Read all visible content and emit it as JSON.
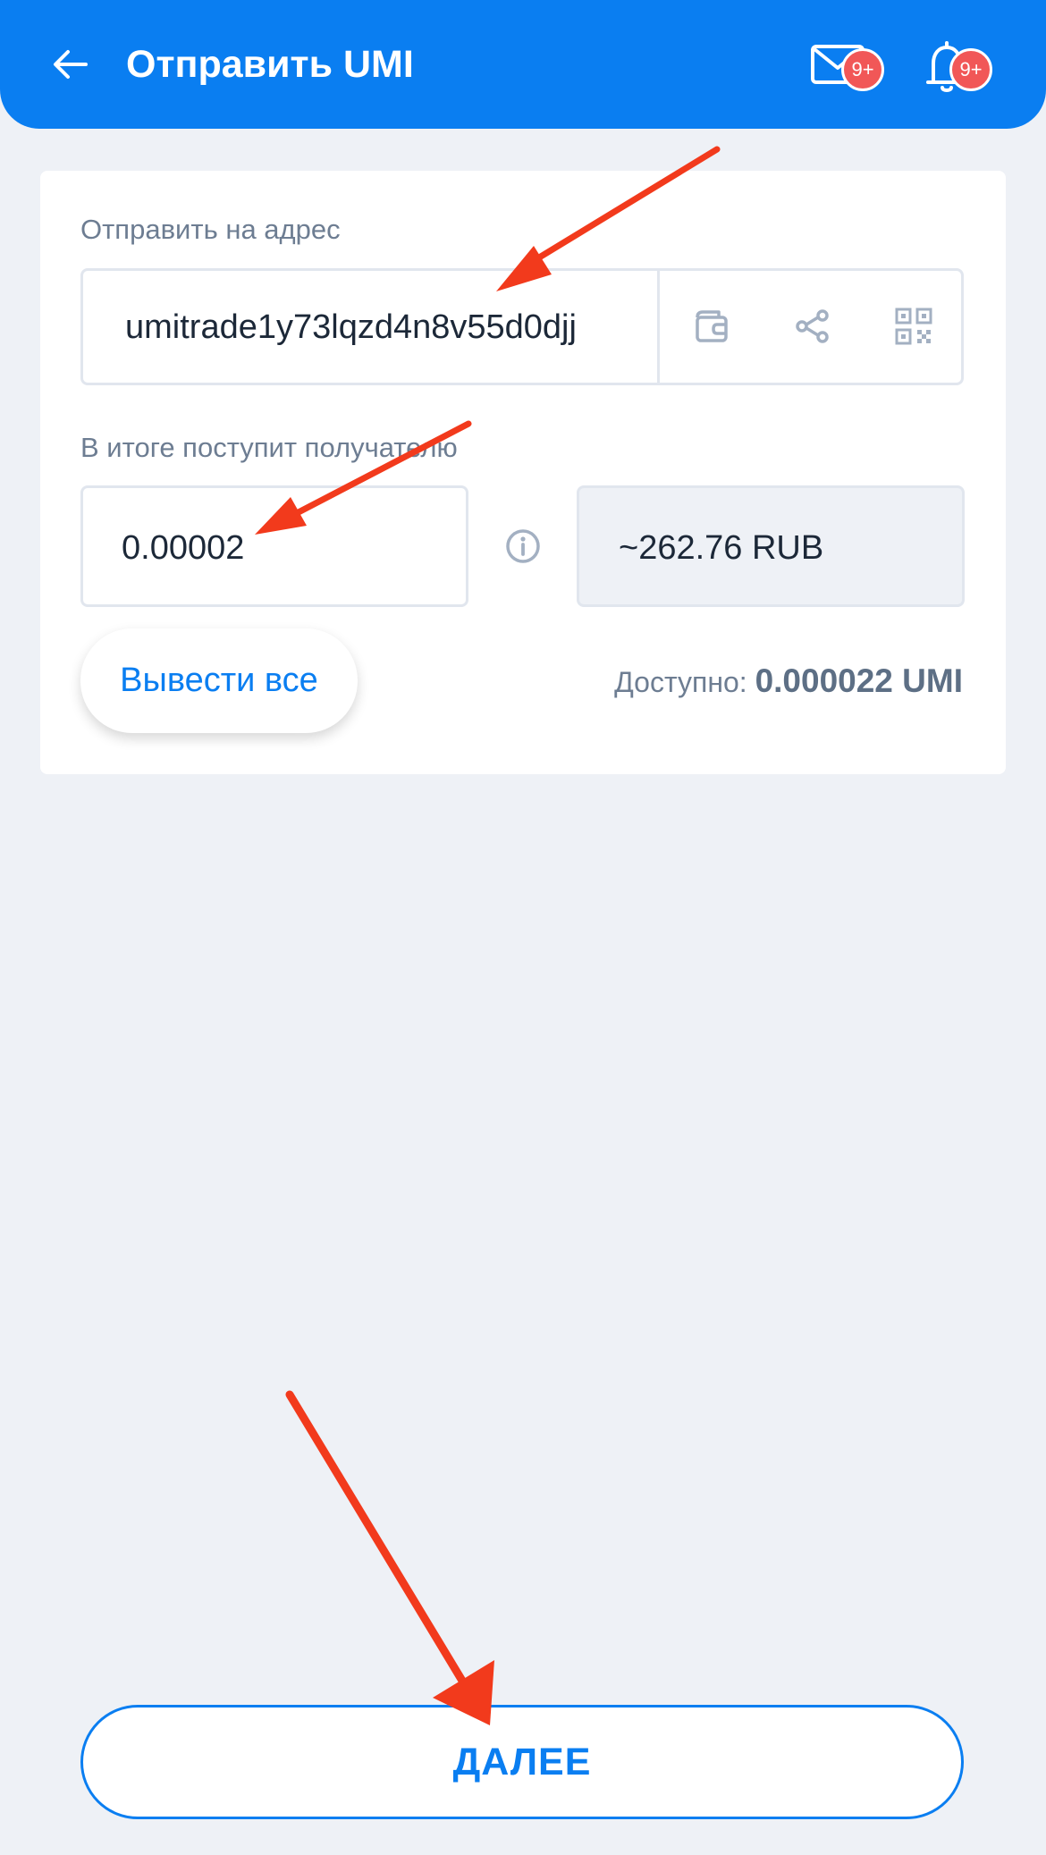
{
  "header": {
    "title": "Отправить UMI",
    "mail_badge": "9+",
    "notifications_badge": "9+"
  },
  "form": {
    "address_label": "Отправить на адрес",
    "address_value": "umitrade1y73lqzd4n8v55d0djj",
    "amount_label": "В итоге поступит получателю",
    "amount_value": "0.00002",
    "fiat_value": "~262.76 RUB",
    "withdraw_all_label": "Вывести все",
    "available_label": "Доступно:",
    "available_value": "0.000022 UMI"
  },
  "footer": {
    "next_label": "ДАЛЕЕ"
  },
  "colors": {
    "accent": "#0a7ef1",
    "badge": "#f15757",
    "background": "#eef1f6",
    "annotation_arrow": "#f23a1c"
  }
}
